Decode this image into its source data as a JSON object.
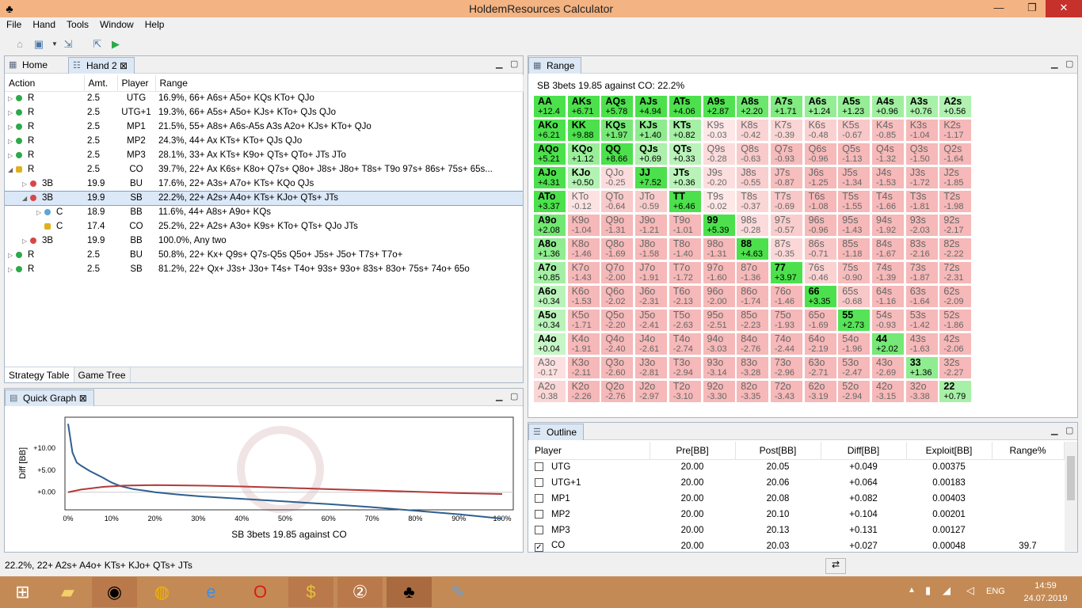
{
  "window": {
    "title": "HoldemResources Calculator",
    "minimize": "—",
    "restore": "❐",
    "close": "✕"
  },
  "menu": [
    "File",
    "Hand",
    "Tools",
    "Window",
    "Help"
  ],
  "tabs": {
    "home": "Home",
    "hand2": "Hand 2"
  },
  "strategy": {
    "columns": [
      "Action",
      "Amt.",
      "Player",
      "Range"
    ],
    "rows": [
      {
        "tri": "▷",
        "dot": "#2da84a",
        "action": "R",
        "amt": "2.5",
        "player": "UTG",
        "range": "16.9%, 66+ A6s+ A5o+ KQs KTo+ QJo",
        "indent": 0
      },
      {
        "tri": "▷",
        "dot": "#2da84a",
        "action": "R",
        "amt": "2.5",
        "player": "UTG+1",
        "range": "19.3%, 66+ A5s+ A5o+ KJs+ KTo+ QJs QJo",
        "indent": 0
      },
      {
        "tri": "▷",
        "dot": "#2da84a",
        "action": "R",
        "amt": "2.5",
        "player": "MP1",
        "range": "21.5%, 55+ A8s+ A6s-A5s A3s A2o+ KJs+ KTo+ QJo",
        "indent": 0
      },
      {
        "tri": "▷",
        "dot": "#2da84a",
        "action": "R",
        "amt": "2.5",
        "player": "MP2",
        "range": "24.3%, 44+ Ax KTs+ KTo+ QJs QJo",
        "indent": 0
      },
      {
        "tri": "▷",
        "dot": "#2da84a",
        "action": "R",
        "amt": "2.5",
        "player": "MP3",
        "range": "28.1%, 33+ Ax KTs+ K9o+ QTs+ QTo+ JTs JTo",
        "indent": 0
      },
      {
        "tri": "◢",
        "lock": true,
        "action": "R",
        "amt": "2.5",
        "player": "CO",
        "range": "39.7%, 22+ Ax K6s+ K8o+ Q7s+ Q8o+ J8s+ J8o+ T8s+ T9o 97s+ 86s+ 75s+ 65s...",
        "indent": 0
      },
      {
        "tri": "▷",
        "dot": "#d6474a",
        "action": "3B",
        "amt": "19.9",
        "player": "BU",
        "range": "17.6%, 22+ A3s+ A7o+ KTs+ KQo QJs",
        "indent": 1
      },
      {
        "tri": "◢",
        "dot": "#d6474a",
        "action": "3B",
        "amt": "19.9",
        "player": "SB",
        "range": "22.2%, 22+ A2s+ A4o+ KTs+ KJo+ QTs+ JTs",
        "indent": 1,
        "selected": true
      },
      {
        "tri": "▷",
        "dot": "#5aa6d8",
        "action": "C",
        "amt": "18.9",
        "player": "BB",
        "range": "11.6%, 44+ A8s+ A9o+ KQs",
        "indent": 2
      },
      {
        "tri": "",
        "lock": true,
        "action": "C",
        "amt": "17.4",
        "player": "CO",
        "range": "25.2%, 22+ A2s+ A3o+ K9s+ KTo+ QTs+ QJo JTs",
        "indent": 2
      },
      {
        "tri": "▷",
        "dot": "#d6474a",
        "action": "3B",
        "amt": "19.9",
        "player": "BB",
        "range": "100.0%, Any two",
        "indent": 1
      },
      {
        "tri": "▷",
        "dot": "#2da84a",
        "action": "R",
        "amt": "2.5",
        "player": "BU",
        "range": "50.8%, 22+ Kx+ Q9s+ Q7s-Q5s Q5o+ J5s+ J5o+ T7s+ T7o+",
        "indent": 0
      },
      {
        "tri": "▷",
        "dot": "#2da84a",
        "action": "R",
        "amt": "2.5",
        "player": "SB",
        "range": "81.2%, 22+ Qx+ J3s+ J3o+ T4s+ T4o+ 93s+ 93o+ 83s+ 83o+ 75s+ 74o+ 65o",
        "indent": 0
      }
    ],
    "bottom_tabs": [
      "Strategy Table",
      "Game Tree"
    ]
  },
  "quick_graph": {
    "tab": "Quick Graph"
  },
  "chart_data": {
    "type": "line",
    "title": "",
    "xlabel": "SB 3bets 19.85 against CO",
    "ylabel": "Diff [BB]",
    "ylim": [
      -4,
      17
    ],
    "xlim": [
      0,
      100
    ],
    "x_ticks": [
      "0%",
      "10%",
      "20%",
      "30%",
      "40%",
      "50%",
      "60%",
      "70%",
      "80%",
      "90%",
      "100%"
    ],
    "y_ticks": [
      "+10.00",
      "+5.00",
      "+0.00"
    ],
    "series": [
      {
        "color": "#2f5f8f",
        "x": [
          0,
          1,
          2,
          3,
          5,
          8,
          10,
          12,
          15,
          18,
          20,
          25,
          30,
          40,
          50,
          60,
          70,
          80,
          90,
          100
        ],
        "y": [
          15.5,
          9,
          6.7,
          6,
          4.8,
          3.3,
          2.2,
          1.4,
          0.7,
          0.3,
          0.0,
          -0.5,
          -0.9,
          -1.5,
          -2.1,
          -2.7,
          -3.4,
          -4.2,
          -5.0,
          -6.0
        ]
      },
      {
        "color": "#b33a3a",
        "x": [
          0,
          3,
          8,
          13,
          20,
          30,
          40,
          50,
          60,
          70,
          80,
          90,
          100
        ],
        "y": [
          0,
          0.6,
          1.2,
          1.5,
          1.6,
          1.5,
          1.3,
          1.0,
          0.7,
          0.4,
          0.1,
          -0.2,
          -0.4
        ]
      }
    ]
  },
  "range": {
    "tab": "Range",
    "summary": "SB 3bets 19.85 against CO: 22.2%",
    "hands": [
      [
        "AA",
        "+12.4"
      ],
      [
        "AKs",
        "+6.71"
      ],
      [
        "AQs",
        "+5.78"
      ],
      [
        "AJs",
        "+4.94"
      ],
      [
        "ATs",
        "+4.06"
      ],
      [
        "A9s",
        "+2.87"
      ],
      [
        "A8s",
        "+2.20"
      ],
      [
        "A7s",
        "+1.71"
      ],
      [
        "A6s",
        "+1.24"
      ],
      [
        "A5s",
        "+1.23"
      ],
      [
        "A4s",
        "+0.96"
      ],
      [
        "A3s",
        "+0.76"
      ],
      [
        "A2s",
        "+0.56"
      ],
      [
        "AKo",
        "+6.21"
      ],
      [
        "KK",
        "+9.88"
      ],
      [
        "KQs",
        "+1.97"
      ],
      [
        "KJs",
        "+1.40"
      ],
      [
        "KTs",
        "+0.82"
      ],
      [
        "K9s",
        "-0.03"
      ],
      [
        "K8s",
        "-0.42"
      ],
      [
        "K7s",
        "-0.39"
      ],
      [
        "K6s",
        "-0.48"
      ],
      [
        "K5s",
        "-0.67"
      ],
      [
        "K4s",
        "-0.85"
      ],
      [
        "K3s",
        "-1.04"
      ],
      [
        "K2s",
        "-1.17"
      ],
      [
        "AQo",
        "+5.21"
      ],
      [
        "KQo",
        "+1.12"
      ],
      [
        "QQ",
        "+8.66"
      ],
      [
        "QJs",
        "+0.69"
      ],
      [
        "QTs",
        "+0.33"
      ],
      [
        "Q9s",
        "-0.28"
      ],
      [
        "Q8s",
        "-0.63"
      ],
      [
        "Q7s",
        "-0.93"
      ],
      [
        "Q6s",
        "-0.96"
      ],
      [
        "Q5s",
        "-1.13"
      ],
      [
        "Q4s",
        "-1.32"
      ],
      [
        "Q3s",
        "-1.50"
      ],
      [
        "Q2s",
        "-1.64"
      ],
      [
        "AJo",
        "+4.31"
      ],
      [
        "KJo",
        "+0.50"
      ],
      [
        "QJo",
        "-0.25"
      ],
      [
        "JJ",
        "+7.52"
      ],
      [
        "JTs",
        "+0.36"
      ],
      [
        "J9s",
        "-0.20"
      ],
      [
        "J8s",
        "-0.55"
      ],
      [
        "J7s",
        "-0.87"
      ],
      [
        "J6s",
        "-1.25"
      ],
      [
        "J5s",
        "-1.34"
      ],
      [
        "J4s",
        "-1.53"
      ],
      [
        "J3s",
        "-1.72"
      ],
      [
        "J2s",
        "-1.85"
      ],
      [
        "ATo",
        "+3.37"
      ],
      [
        "KTo",
        "-0.12"
      ],
      [
        "QTo",
        "-0.64"
      ],
      [
        "JTo",
        "-0.59"
      ],
      [
        "TT",
        "+6.46"
      ],
      [
        "T9s",
        "-0.02"
      ],
      [
        "T8s",
        "-0.37"
      ],
      [
        "T7s",
        "-0.69"
      ],
      [
        "T6s",
        "-1.08"
      ],
      [
        "T5s",
        "-1.55"
      ],
      [
        "T4s",
        "-1.66"
      ],
      [
        "T3s",
        "-1.81"
      ],
      [
        "T2s",
        "-1.98"
      ],
      [
        "A9o",
        "+2.08"
      ],
      [
        "K9o",
        "-1.04"
      ],
      [
        "Q9o",
        "-1.31"
      ],
      [
        "J9o",
        "-1.21"
      ],
      [
        "T9o",
        "-1.01"
      ],
      [
        "99",
        "+5.39"
      ],
      [
        "98s",
        "-0.28"
      ],
      [
        "97s",
        "-0.57"
      ],
      [
        "96s",
        "-0.96"
      ],
      [
        "95s",
        "-1.43"
      ],
      [
        "94s",
        "-1.92"
      ],
      [
        "93s",
        "-2.03"
      ],
      [
        "92s",
        "-2.17"
      ],
      [
        "A8o",
        "+1.36"
      ],
      [
        "K8o",
        "-1.46"
      ],
      [
        "Q8o",
        "-1.69"
      ],
      [
        "J8o",
        "-1.58"
      ],
      [
        "T8o",
        "-1.40"
      ],
      [
        "98o",
        "-1.31"
      ],
      [
        "88",
        "+4.63"
      ],
      [
        "87s",
        "-0.35"
      ],
      [
        "86s",
        "-0.71"
      ],
      [
        "85s",
        "-1.18"
      ],
      [
        "84s",
        "-1.67"
      ],
      [
        "83s",
        "-2.16"
      ],
      [
        "82s",
        "-2.22"
      ],
      [
        "A7o",
        "+0.85"
      ],
      [
        "K7o",
        "-1.43"
      ],
      [
        "Q7o",
        "-2.00"
      ],
      [
        "J7o",
        "-1.91"
      ],
      [
        "T7o",
        "-1.72"
      ],
      [
        "97o",
        "-1.60"
      ],
      [
        "87o",
        "-1.36"
      ],
      [
        "77",
        "+3.97"
      ],
      [
        "76s",
        "-0.46"
      ],
      [
        "75s",
        "-0.90"
      ],
      [
        "74s",
        "-1.39"
      ],
      [
        "73s",
        "-1.87"
      ],
      [
        "72s",
        "-2.31"
      ],
      [
        "A6o",
        "+0.34"
      ],
      [
        "K6o",
        "-1.53"
      ],
      [
        "Q6o",
        "-2.02"
      ],
      [
        "J6o",
        "-2.31"
      ],
      [
        "T6o",
        "-2.13"
      ],
      [
        "96o",
        "-2.00"
      ],
      [
        "86o",
        "-1.74"
      ],
      [
        "76o",
        "-1.46"
      ],
      [
        "66",
        "+3.35"
      ],
      [
        "65s",
        "-0.68"
      ],
      [
        "64s",
        "-1.16"
      ],
      [
        "63s",
        "-1.64"
      ],
      [
        "62s",
        "-2.09"
      ],
      [
        "A5o",
        "+0.34"
      ],
      [
        "K5o",
        "-1.71"
      ],
      [
        "Q5o",
        "-2.20"
      ],
      [
        "J5o",
        "-2.41"
      ],
      [
        "T5o",
        "-2.63"
      ],
      [
        "95o",
        "-2.51"
      ],
      [
        "85o",
        "-2.23"
      ],
      [
        "75o",
        "-1.93"
      ],
      [
        "65o",
        "-1.69"
      ],
      [
        "55",
        "+2.73"
      ],
      [
        "54s",
        "-0.93"
      ],
      [
        "53s",
        "-1.42"
      ],
      [
        "52s",
        "-1.86"
      ],
      [
        "A4o",
        "+0.04"
      ],
      [
        "K4o",
        "-1.91"
      ],
      [
        "Q4o",
        "-2.40"
      ],
      [
        "J4o",
        "-2.61"
      ],
      [
        "T4o",
        "-2.74"
      ],
      [
        "94o",
        "-3.03"
      ],
      [
        "84o",
        "-2.76"
      ],
      [
        "74o",
        "-2.44"
      ],
      [
        "64o",
        "-2.19"
      ],
      [
        "54o",
        "-1.96"
      ],
      [
        "44",
        "+2.02"
      ],
      [
        "43s",
        "-1.63"
      ],
      [
        "42s",
        "-2.06"
      ],
      [
        "A3o",
        "-0.17"
      ],
      [
        "K3o",
        "-2.11"
      ],
      [
        "Q3o",
        "-2.60"
      ],
      [
        "J3o",
        "-2.81"
      ],
      [
        "T3o",
        "-2.94"
      ],
      [
        "93o",
        "-3.14"
      ],
      [
        "83o",
        "-3.28"
      ],
      [
        "73o",
        "-2.96"
      ],
      [
        "63o",
        "-2.71"
      ],
      [
        "53o",
        "-2.47"
      ],
      [
        "43o",
        "-2.69"
      ],
      [
        "33",
        "+1.36"
      ],
      [
        "32s",
        "-2.27"
      ],
      [
        "A2o",
        "-0.38"
      ],
      [
        "K2o",
        "-2.26"
      ],
      [
        "Q2o",
        "-2.76"
      ],
      [
        "J2o",
        "-2.97"
      ],
      [
        "T2o",
        "-3.10"
      ],
      [
        "92o",
        "-3.30"
      ],
      [
        "82o",
        "-3.35"
      ],
      [
        "72o",
        "-3.43"
      ],
      [
        "62o",
        "-3.19"
      ],
      [
        "52o",
        "-2.94"
      ],
      [
        "42o",
        "-3.15"
      ],
      [
        "32o",
        "-3.38"
      ],
      [
        "22",
        "+0.79"
      ]
    ]
  },
  "outline": {
    "tab": "Outline",
    "columns": [
      "Player",
      "Pre[BB]",
      "Post[BB]",
      "Diff[BB]",
      "Exploit[BB]",
      "Range%"
    ],
    "rows": [
      {
        "checked": false,
        "player": "UTG",
        "pre": "20.00",
        "post": "20.05",
        "diff": "+0.049",
        "exploit": "0.00375",
        "range": ""
      },
      {
        "checked": false,
        "player": "UTG+1",
        "pre": "20.00",
        "post": "20.06",
        "diff": "+0.064",
        "exploit": "0.00183",
        "range": ""
      },
      {
        "checked": false,
        "player": "MP1",
        "pre": "20.00",
        "post": "20.08",
        "diff": "+0.082",
        "exploit": "0.00403",
        "range": ""
      },
      {
        "checked": false,
        "player": "MP2",
        "pre": "20.00",
        "post": "20.10",
        "diff": "+0.104",
        "exploit": "0.00201",
        "range": ""
      },
      {
        "checked": false,
        "player": "MP3",
        "pre": "20.00",
        "post": "20.13",
        "diff": "+0.131",
        "exploit": "0.00127",
        "range": ""
      },
      {
        "checked": true,
        "player": "CO",
        "pre": "20.00",
        "post": "20.03",
        "diff": "+0.027",
        "exploit": "0.00048",
        "range": "39.7"
      }
    ]
  },
  "statusbar": {
    "text": "22.2%, 22+ A2s+ A4o+ KTs+ KJo+ QTs+ JTs"
  },
  "taskbar": {
    "lang": "ENG",
    "time": "14:59",
    "date": "24.07.2019"
  },
  "colors": {
    "in_range_strong": "#4ce04c",
    "in_range_light": "#c8f5c8",
    "out_range": "#f6b8b8",
    "out_range_light": "#fde6e6",
    "selection": "#dbe8f8"
  }
}
